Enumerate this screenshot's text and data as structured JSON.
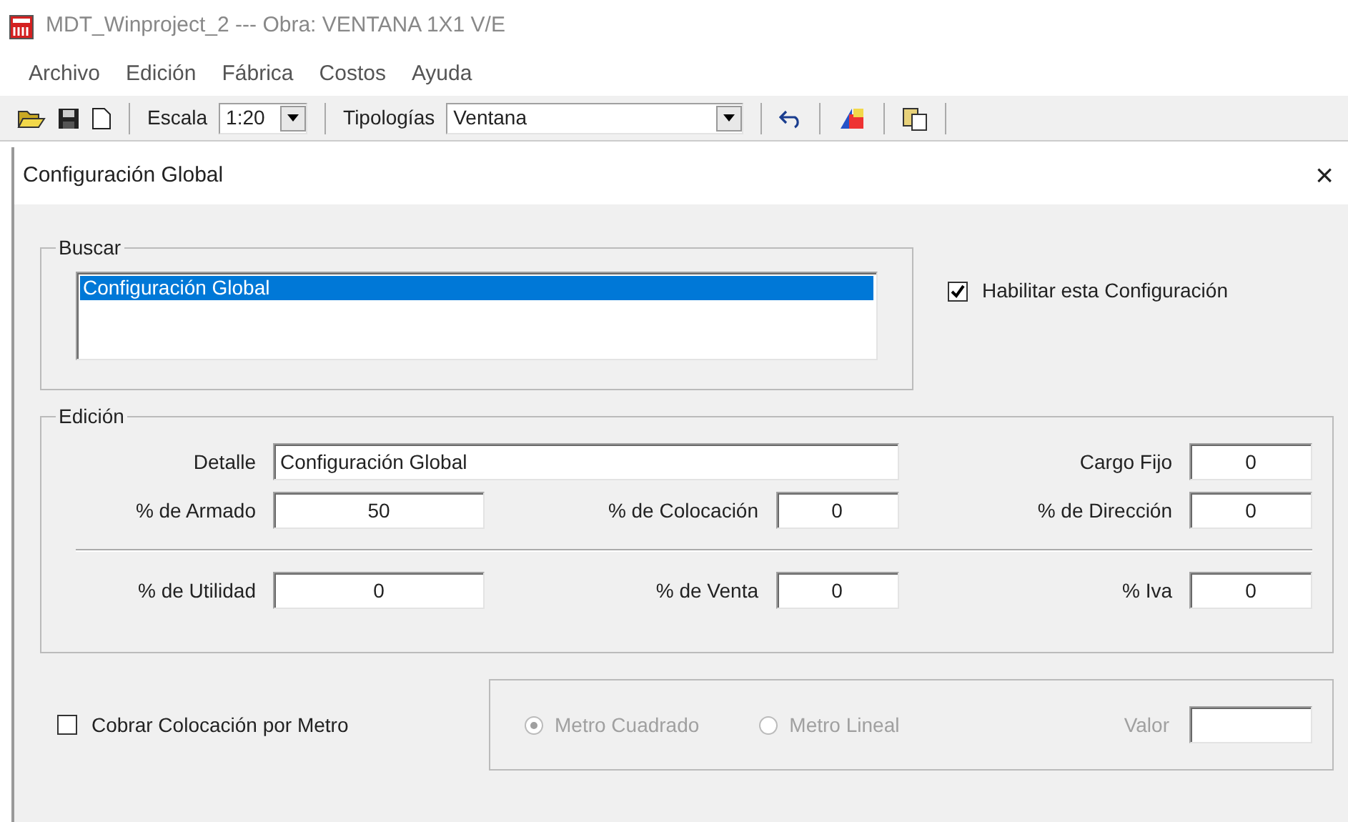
{
  "window": {
    "title": "MDT_Winproject_2 --- Obra: VENTANA 1X1 V/E"
  },
  "menu": [
    "Archivo",
    "Edición",
    "Fábrica",
    "Costos",
    "Ayuda"
  ],
  "toolbar": {
    "scale_label": "Escala",
    "scale_value": "1:20",
    "typology_label": "Tipologías",
    "typology_value": "Ventana"
  },
  "dialog": {
    "title": "Configuración Global",
    "close": "×",
    "buscar": {
      "legend": "Buscar",
      "items": [
        {
          "label": "Configuración Global",
          "selected": true
        }
      ],
      "enable": {
        "label": "Habilitar esta Configuración",
        "checked": true
      }
    },
    "edicion": {
      "legend": "Edición",
      "detalle": {
        "label": "Detalle",
        "value": "Configuración Global"
      },
      "fields": [
        {
          "label": "Cargo Fijo",
          "value": "0"
        },
        {
          "label": "% de Armado",
          "value": "50"
        },
        {
          "label": "% de Colocación",
          "value": "0"
        },
        {
          "label": "% de Dirección",
          "value": "0"
        },
        {
          "label": "% de Utilidad",
          "value": "0"
        },
        {
          "label": "% de Venta",
          "value": "0"
        },
        {
          "label": "% Iva",
          "value": "0"
        }
      ]
    },
    "cobrar": {
      "label": "Cobrar Colocación por Metro",
      "checked": false
    },
    "medida": {
      "disabled": true,
      "options": [
        {
          "label": "Metro Cuadrado",
          "selected": true
        },
        {
          "label": "Metro Lineal",
          "selected": false
        }
      ],
      "valor_label": "Valor"
    }
  }
}
